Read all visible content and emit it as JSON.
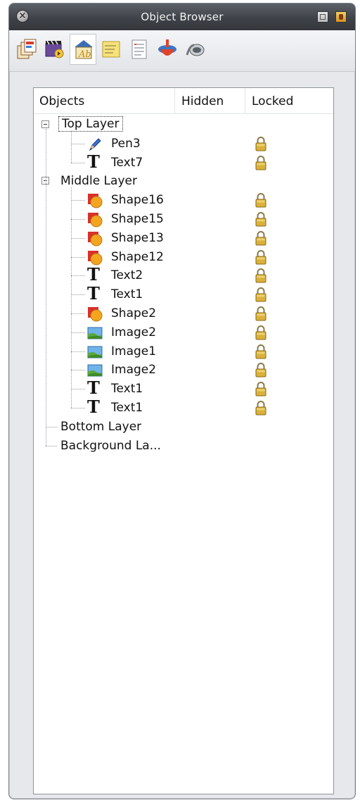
{
  "window": {
    "title": "Object Browser"
  },
  "toolbar": {
    "tools": [
      {
        "name": "page-browser-icon"
      },
      {
        "name": "flipchart-media-icon"
      },
      {
        "name": "object-browser-icon",
        "active": true
      },
      {
        "name": "notes-icon"
      },
      {
        "name": "properties-icon"
      },
      {
        "name": "action-browser-icon"
      },
      {
        "name": "voting-browser-icon"
      }
    ]
  },
  "table": {
    "columns": [
      "Objects",
      "Hidden",
      "Locked"
    ]
  },
  "tree": [
    {
      "type": "layer",
      "label": "Top Layer",
      "expanded": true,
      "focused": true
    },
    {
      "type": "child",
      "label": "Pen3",
      "icon": "pen-icon",
      "locked": true
    },
    {
      "type": "child",
      "label": "Text7",
      "icon": "text-icon",
      "locked": true
    },
    {
      "type": "layer",
      "label": "Middle Layer",
      "expanded": true
    },
    {
      "type": "child",
      "label": "Shape16",
      "icon": "shape-icon",
      "locked": true
    },
    {
      "type": "child",
      "label": "Shape15",
      "icon": "shape-icon",
      "locked": true
    },
    {
      "type": "child",
      "label": "Shape13",
      "icon": "shape-icon",
      "locked": true
    },
    {
      "type": "child",
      "label": "Shape12",
      "icon": "shape-icon",
      "locked": true
    },
    {
      "type": "child",
      "label": "Text2",
      "icon": "text-icon",
      "locked": true
    },
    {
      "type": "child",
      "label": "Text1",
      "icon": "text-icon",
      "locked": true
    },
    {
      "type": "child",
      "label": "Shape2",
      "icon": "shape-icon",
      "locked": true
    },
    {
      "type": "child",
      "label": "Image2",
      "icon": "image-icon",
      "locked": true
    },
    {
      "type": "child",
      "label": "Image1",
      "icon": "image-icon",
      "locked": true
    },
    {
      "type": "child",
      "label": "Image2",
      "icon": "image-icon",
      "locked": true
    },
    {
      "type": "child",
      "label": "Text1",
      "icon": "text-icon",
      "locked": true
    },
    {
      "type": "child",
      "label": "Text1",
      "icon": "text-icon",
      "locked": true
    },
    {
      "type": "layer",
      "label": "Bottom Layer"
    },
    {
      "type": "layer",
      "label": "Background La..."
    }
  ],
  "colors": {
    "titlebar": "#3f4349",
    "panel_bg": "#ffffff",
    "lock": "#d9b13b",
    "shape_red": "#d8312a",
    "shape_orange": "#f3a51f"
  }
}
